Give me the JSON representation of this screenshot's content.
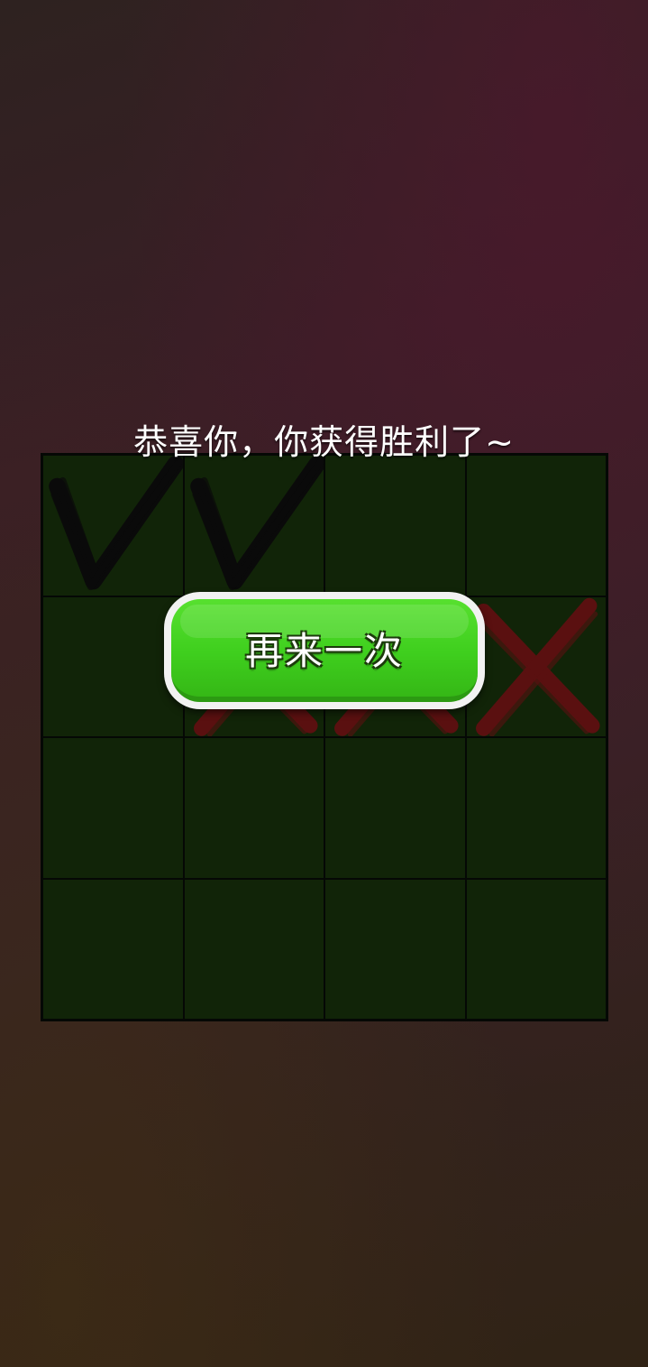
{
  "message": "恭喜你，你获得胜利了~",
  "retry_button": {
    "label": "再来一次"
  },
  "board": {
    "rows": 4,
    "cols": 4,
    "cells": [
      [
        "check",
        "check",
        "",
        ""
      ],
      [
        "",
        "cross",
        "cross",
        "cross"
      ],
      [
        "",
        "",
        "",
        ""
      ],
      [
        "",
        "",
        "",
        ""
      ]
    ]
  },
  "colors": {
    "cell_bg": "#112408",
    "check_mark": "#0a0a0a",
    "cross_mark": "#5a1010",
    "button_green": "#45d323"
  }
}
